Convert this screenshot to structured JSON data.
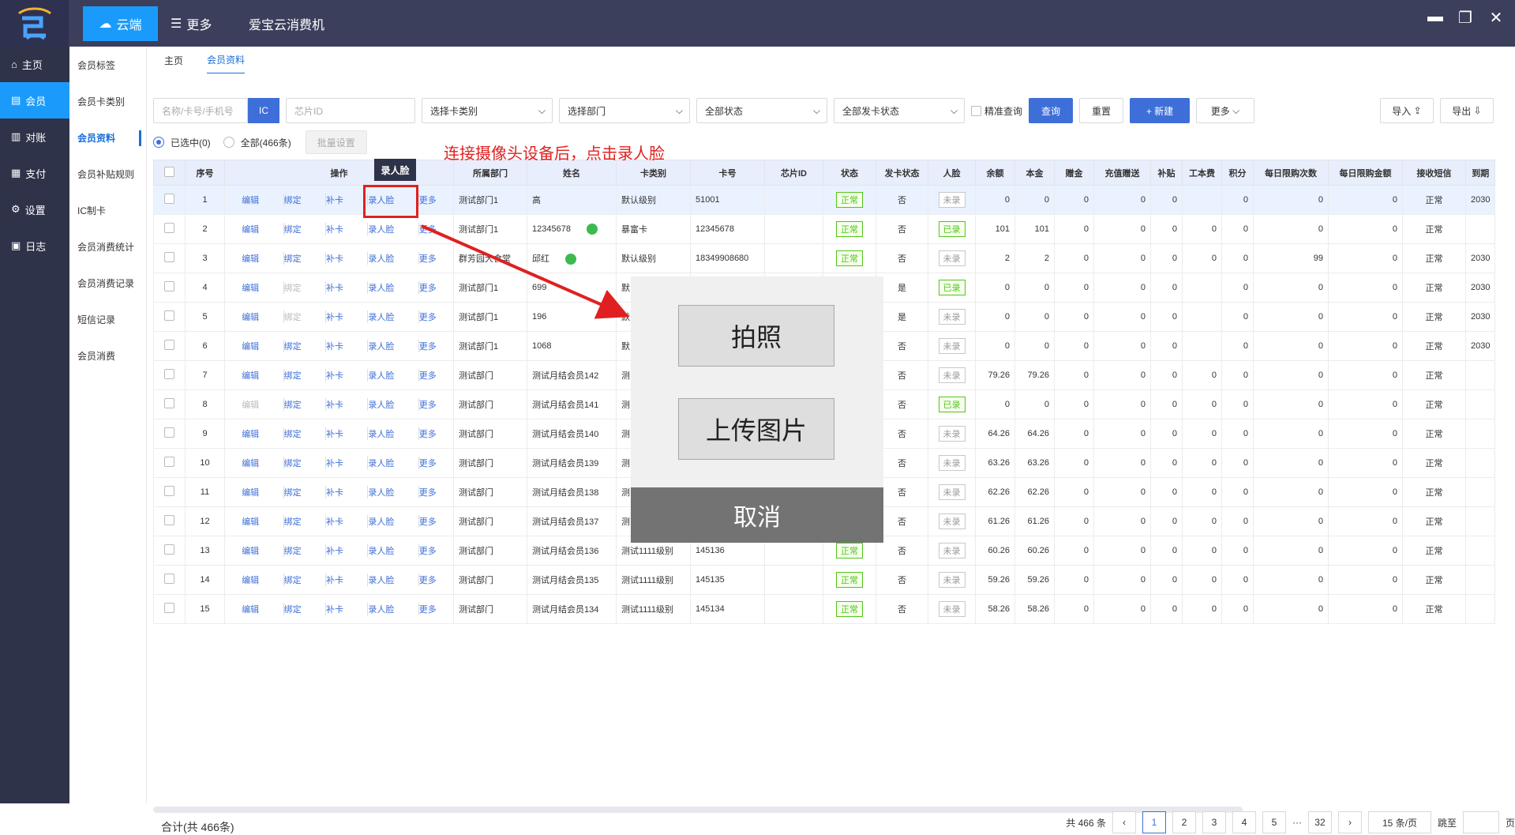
{
  "topbar": {
    "cloud_tab": "云端",
    "more_tab": "更多",
    "app_title": "爱宝云消费机"
  },
  "sidebar": {
    "items": [
      {
        "label": "主页",
        "icon": "home-icon"
      },
      {
        "label": "会员",
        "icon": "member-icon"
      },
      {
        "label": "对账",
        "icon": "reconcile-icon"
      },
      {
        "label": "支付",
        "icon": "pay-icon"
      },
      {
        "label": "设置",
        "icon": "gear-icon"
      },
      {
        "label": "日志",
        "icon": "log-icon"
      }
    ]
  },
  "subnav": {
    "items": [
      "会员标签",
      "会员卡类别",
      "会员资料",
      "会员补贴规则",
      "IC制卡",
      "会员消费统计",
      "会员消费记录",
      "短信记录",
      "会员消费"
    ]
  },
  "crumbs": {
    "home": "主页",
    "current": "会员资料"
  },
  "filters": {
    "search_placeholder": "名称/卡号/手机号",
    "ic_label": "IC",
    "chip_placeholder": "芯片ID",
    "card_type": "选择卡类别",
    "dept": "选择部门",
    "status": "全部状态",
    "issue_status": "全部发卡状态",
    "exact_label": "精准查询",
    "query": "查询",
    "reset": "重置",
    "new": "+ 新建",
    "more": "更多",
    "import": "导入",
    "export": "导出"
  },
  "selection": {
    "selected": "已选中(0)",
    "all": "全部(466条)",
    "batch": "批量设置"
  },
  "table": {
    "headers": [
      "序号",
      "操作",
      "所属部门",
      "姓名",
      "卡类别",
      "卡号",
      "芯片ID",
      "状态",
      "发卡状态",
      "人脸",
      "余额",
      "本金",
      "赠金",
      "充值赠送",
      "补贴",
      "工本费",
      "积分",
      "每日限购次数",
      "每日限购金额",
      "接收短信",
      "到期"
    ],
    "op_labels": {
      "edit": "编辑",
      "bind": "绑定",
      "reissue": "补卡",
      "face": "录人脸",
      "more": "更多"
    },
    "rows": [
      {
        "no": "1",
        "dept": "测试部门1",
        "name": "高",
        "type": "默认级别",
        "card": "51001",
        "status": "正常",
        "issued": "否",
        "face": "未录",
        "bal": "0",
        "principal": "0",
        "gift": "0",
        "rg": "0",
        "sub": "0",
        "cost": "",
        "pts": "0",
        "cnt": "0",
        "amt": "0",
        "sms": "正常",
        "exp": "2030"
      },
      {
        "no": "2",
        "dept": "测试部门1",
        "name": "12345678",
        "type": "暴富卡",
        "card": "12345678",
        "status": "正常",
        "issued": "否",
        "face": "已录",
        "bal": "101",
        "principal": "101",
        "gift": "0",
        "rg": "0",
        "sub": "0",
        "cost": "0",
        "pts": "0",
        "cnt": "0",
        "amt": "0",
        "sms": "正常",
        "exp": ""
      },
      {
        "no": "3",
        "dept": "群芳园大食堂",
        "name": "邱红",
        "type": "默认级别",
        "card": "18349908680",
        "status": "正常",
        "issued": "否",
        "face": "未录",
        "bal": "2",
        "principal": "2",
        "gift": "0",
        "rg": "0",
        "sub": "0",
        "cost": "0",
        "pts": "0",
        "cnt": "99",
        "amt": "0",
        "sms": "正常",
        "exp": "2030"
      },
      {
        "no": "4",
        "dept": "测试部门1",
        "name": "699",
        "type": "默",
        "card": "",
        "status": "",
        "issued": "是",
        "face": "已录",
        "bal": "0",
        "principal": "0",
        "gift": "0",
        "rg": "0",
        "sub": "0",
        "cost": "",
        "pts": "0",
        "cnt": "0",
        "amt": "0",
        "sms": "正常",
        "exp": "2030"
      },
      {
        "no": "5",
        "dept": "测试部门1",
        "name": "196",
        "type": "默",
        "card": "",
        "status": "",
        "issued": "是",
        "face": "未录",
        "bal": "0",
        "principal": "0",
        "gift": "0",
        "rg": "0",
        "sub": "0",
        "cost": "",
        "pts": "0",
        "cnt": "0",
        "amt": "0",
        "sms": "正常",
        "exp": "2030"
      },
      {
        "no": "6",
        "dept": "测试部门1",
        "name": "1068",
        "type": "默",
        "card": "",
        "status": "",
        "issued": "否",
        "face": "未录",
        "bal": "0",
        "principal": "0",
        "gift": "0",
        "rg": "0",
        "sub": "0",
        "cost": "",
        "pts": "0",
        "cnt": "0",
        "amt": "0",
        "sms": "正常",
        "exp": "2030"
      },
      {
        "no": "7",
        "dept": "测试部门",
        "name": "测试月结会员142",
        "type": "测",
        "card": "",
        "status": "",
        "issued": "否",
        "face": "未录",
        "bal": "79.26",
        "principal": "79.26",
        "gift": "0",
        "rg": "0",
        "sub": "0",
        "cost": "0",
        "pts": "0",
        "cnt": "0",
        "amt": "0",
        "sms": "正常",
        "exp": ""
      },
      {
        "no": "8",
        "dept": "测试部门",
        "name": "测试月结会员141",
        "type": "测",
        "card": "",
        "status": "",
        "issued": "否",
        "face": "已录",
        "bal": "0",
        "principal": "0",
        "gift": "0",
        "rg": "0",
        "sub": "0",
        "cost": "0",
        "pts": "0",
        "cnt": "0",
        "amt": "0",
        "sms": "正常",
        "exp": ""
      },
      {
        "no": "9",
        "dept": "测试部门",
        "name": "测试月结会员140",
        "type": "测",
        "card": "",
        "status": "",
        "issued": "否",
        "face": "未录",
        "bal": "64.26",
        "principal": "64.26",
        "gift": "0",
        "rg": "0",
        "sub": "0",
        "cost": "0",
        "pts": "0",
        "cnt": "0",
        "amt": "0",
        "sms": "正常",
        "exp": ""
      },
      {
        "no": "10",
        "dept": "测试部门",
        "name": "测试月结会员139",
        "type": "测",
        "card": "",
        "status": "",
        "issued": "否",
        "face": "未录",
        "bal": "63.26",
        "principal": "63.26",
        "gift": "0",
        "rg": "0",
        "sub": "0",
        "cost": "0",
        "pts": "0",
        "cnt": "0",
        "amt": "0",
        "sms": "正常",
        "exp": ""
      },
      {
        "no": "11",
        "dept": "测试部门",
        "name": "测试月结会员138",
        "type": "测",
        "card": "",
        "status": "",
        "issued": "否",
        "face": "未录",
        "bal": "62.26",
        "principal": "62.26",
        "gift": "0",
        "rg": "0",
        "sub": "0",
        "cost": "0",
        "pts": "0",
        "cnt": "0",
        "amt": "0",
        "sms": "正常",
        "exp": ""
      },
      {
        "no": "12",
        "dept": "测试部门",
        "name": "测试月结会员137",
        "type": "测",
        "card": "",
        "status": "",
        "issued": "否",
        "face": "未录",
        "bal": "61.26",
        "principal": "61.26",
        "gift": "0",
        "rg": "0",
        "sub": "0",
        "cost": "0",
        "pts": "0",
        "cnt": "0",
        "amt": "0",
        "sms": "正常",
        "exp": ""
      },
      {
        "no": "13",
        "dept": "测试部门",
        "name": "测试月结会员136",
        "type": "测试1111级别",
        "card": "145136",
        "status": "正常",
        "issued": "否",
        "face": "未录",
        "bal": "60.26",
        "principal": "60.26",
        "gift": "0",
        "rg": "0",
        "sub": "0",
        "cost": "0",
        "pts": "0",
        "cnt": "0",
        "amt": "0",
        "sms": "正常",
        "exp": ""
      },
      {
        "no": "14",
        "dept": "测试部门",
        "name": "测试月结会员135",
        "type": "测试1111级别",
        "card": "145135",
        "status": "正常",
        "issued": "否",
        "face": "未录",
        "bal": "59.26",
        "principal": "59.26",
        "gift": "0",
        "rg": "0",
        "sub": "0",
        "cost": "0",
        "pts": "0",
        "cnt": "0",
        "amt": "0",
        "sms": "正常",
        "exp": ""
      },
      {
        "no": "15",
        "dept": "测试部门",
        "name": "测试月结会员134",
        "type": "测试1111级别",
        "card": "145134",
        "status": "正常",
        "issued": "否",
        "face": "未录",
        "bal": "58.26",
        "principal": "58.26",
        "gift": "0",
        "rg": "0",
        "sub": "0",
        "cost": "0",
        "pts": "0",
        "cnt": "0",
        "amt": "0",
        "sms": "正常",
        "exp": ""
      }
    ]
  },
  "tooltip": "录人脸",
  "annotation": "连接摄像头设备后，点击录人脸",
  "modal": {
    "photo": "拍照",
    "upload": "上传图片",
    "cancel": "取消"
  },
  "footer": {
    "total": "合计(共 466条)",
    "count": "共 466 条",
    "pages": [
      "1",
      "2",
      "3",
      "4",
      "5",
      "32"
    ],
    "ellipsis": "···",
    "per_page": "15 条/页",
    "goto": "跳至",
    "page_unit": "页"
  },
  "colors": {
    "accent": "#3e6fd8",
    "topbar": "#3b3f5c",
    "annotation": "#e02020"
  }
}
